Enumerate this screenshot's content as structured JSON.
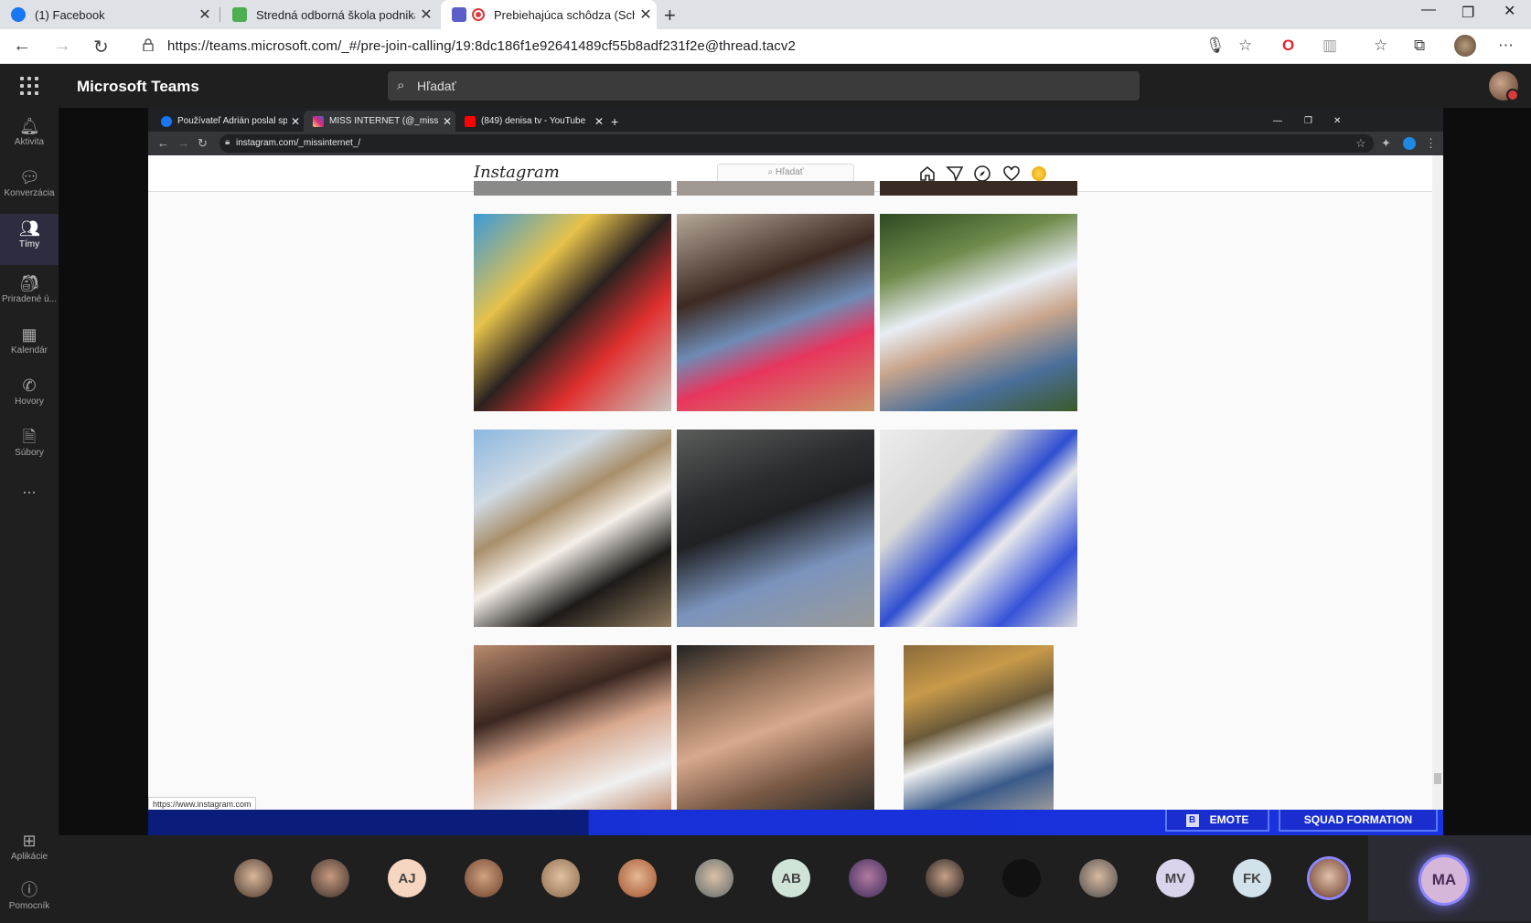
{
  "browser": {
    "tabs": [
      {
        "title": "(1) Facebook",
        "favicon": "facebook-icon",
        "color": "#1877f2"
      },
      {
        "title": "Stredná odborná škola podnikan",
        "favicon": "edupage-icon",
        "color": "#4caf50"
      },
      {
        "title": "Prebiehajúca schôdza (Sch",
        "favicon": "teams-icon",
        "color": "#5b5fc7",
        "active": true
      }
    ],
    "url": "https://teams.microsoft.com/_#/pre-join-calling/19:8dc186f1e92641489cf55b8adf231f2e@thread.tacv2"
  },
  "teams": {
    "app_title": "Microsoft Teams",
    "search_placeholder": "Hľadať",
    "rail": [
      {
        "label": "Aktivita",
        "icon": "bell-icon"
      },
      {
        "label": "Konverzácia",
        "icon": "chat-icon"
      },
      {
        "label": "Tímy",
        "icon": "teams-icon",
        "active": true
      },
      {
        "label": "Priradené ú...",
        "icon": "assignments-icon"
      },
      {
        "label": "Kalendár",
        "icon": "calendar-icon"
      },
      {
        "label": "Hovory",
        "icon": "phone-icon"
      },
      {
        "label": "Súbory",
        "icon": "files-icon"
      },
      {
        "label": "...",
        "icon": "more-icon"
      }
    ],
    "rail_bottom": [
      {
        "label": "Aplikácie",
        "icon": "apps-icon"
      },
      {
        "label": "Pomocník",
        "icon": "help-icon"
      }
    ]
  },
  "shared": {
    "tabs": [
      {
        "title": "Používateľ Adrián poslal správu s",
        "favicon": "facebook-icon",
        "color": "#1877f2"
      },
      {
        "title": "MISS INTERNET (@_missinternet",
        "favicon": "instagram-icon",
        "color": "#d62976",
        "active": true
      },
      {
        "title": "(849) denisa tv - YouTube",
        "favicon": "youtube-icon",
        "color": "#ff0000"
      }
    ],
    "url": "instagram.com/_missinternet_/",
    "ig_logo": "Instagram",
    "ig_search": "Hľadať",
    "status_url": "https://www.instagram.com",
    "game_buttons": {
      "emote": "EMOTE",
      "squad": "SQUAD FORMATION"
    }
  },
  "participants": [
    {
      "initials": "",
      "kind": "photo"
    },
    {
      "initials": "",
      "kind": "photo"
    },
    {
      "initials": "AJ",
      "bg": "#f6d5c1"
    },
    {
      "initials": "",
      "kind": "photo"
    },
    {
      "initials": "",
      "kind": "photo"
    },
    {
      "initials": "",
      "kind": "photo"
    },
    {
      "initials": "",
      "kind": "photo"
    },
    {
      "initials": "AB",
      "bg": "#cfe3d6"
    },
    {
      "initials": "",
      "kind": "photo"
    },
    {
      "initials": "",
      "kind": "photo"
    },
    {
      "initials": "",
      "kind": "photo"
    },
    {
      "initials": "",
      "kind": "photo"
    },
    {
      "initials": "MV",
      "bg": "#d9d3ec"
    },
    {
      "initials": "FK",
      "bg": "#d2e2ea"
    },
    {
      "initials": "",
      "kind": "photo"
    }
  ],
  "me": {
    "initials": "MA"
  }
}
